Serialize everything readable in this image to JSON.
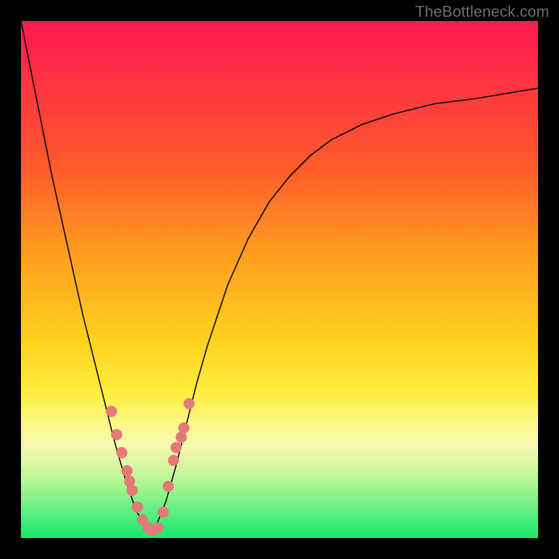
{
  "watermark": "TheBottleneck.com",
  "chart_data": {
    "type": "line",
    "title": "",
    "xlabel": "",
    "ylabel": "",
    "x": [
      0.0,
      0.02,
      0.04,
      0.06,
      0.08,
      0.1,
      0.12,
      0.14,
      0.16,
      0.18,
      0.2,
      0.22,
      0.24,
      0.25,
      0.26,
      0.28,
      0.3,
      0.32,
      0.34,
      0.36,
      0.38,
      0.4,
      0.44,
      0.48,
      0.52,
      0.56,
      0.6,
      0.66,
      0.72,
      0.8,
      0.88,
      0.94,
      1.0
    ],
    "values": [
      1.0,
      0.9,
      0.8,
      0.7,
      0.61,
      0.52,
      0.43,
      0.35,
      0.27,
      0.19,
      0.12,
      0.06,
      0.02,
      0.01,
      0.02,
      0.07,
      0.14,
      0.22,
      0.3,
      0.37,
      0.43,
      0.49,
      0.58,
      0.65,
      0.7,
      0.74,
      0.77,
      0.8,
      0.82,
      0.84,
      0.85,
      0.86,
      0.87
    ],
    "xlim": [
      0,
      1
    ],
    "ylim": [
      0,
      1
    ],
    "markers": {
      "x": [
        0.175,
        0.185,
        0.195,
        0.205,
        0.21,
        0.215,
        0.225,
        0.235,
        0.245,
        0.255,
        0.265,
        0.275,
        0.285,
        0.295,
        0.3,
        0.31,
        0.315,
        0.325
      ],
      "y": [
        0.245,
        0.2,
        0.165,
        0.13,
        0.11,
        0.092,
        0.06,
        0.035,
        0.02,
        0.015,
        0.02,
        0.05,
        0.1,
        0.15,
        0.175,
        0.195,
        0.213,
        0.26
      ],
      "color": "#e47a78",
      "size": 16
    },
    "line_color": "#000000"
  }
}
